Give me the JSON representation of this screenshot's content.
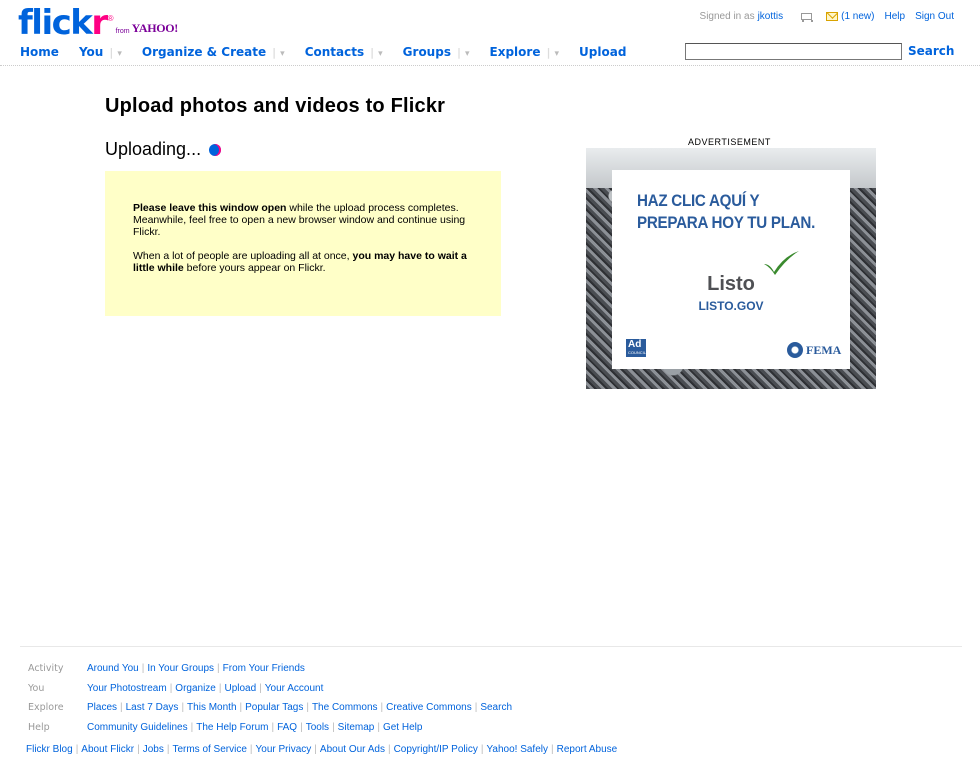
{
  "brand": {
    "flick": "flick",
    "r": "r",
    "reg": "®",
    "from": "from",
    "yahoo": "YAHOO!"
  },
  "account": {
    "signed_in_as": "Signed in as",
    "username": "jkottis",
    "new_mail": "(1 new)",
    "help": "Help",
    "sign_out": "Sign Out"
  },
  "nav": {
    "home": "Home",
    "you": "You",
    "organize": "Organize & Create",
    "contacts": "Contacts",
    "groups": "Groups",
    "explore": "Explore",
    "upload": "Upload",
    "dropdown_glyph": "▾"
  },
  "search": {
    "value": "",
    "button": "Search"
  },
  "main": {
    "title": "Upload photos and videos to Flickr",
    "status": "Uploading...",
    "notice_p1_bold": "Please leave this window open",
    "notice_p1_rest": " while the upload process completes. Meanwhile, feel free to open a new browser window and continue using Flickr.",
    "notice_p2_start": "When a lot of people are uploading all at once, ",
    "notice_p2_bold": "you may have to wait a little while",
    "notice_p2_end": " before yours appear on Flickr."
  },
  "ad": {
    "label": "ADVERTISEMENT",
    "headline_line1": "HAZ CLIC AQUÍ Y",
    "headline_line2": "PREPARA HOY TU PLAN.",
    "brand": "Listo",
    "url": "LISTO.GOV",
    "adcouncil": "Ad",
    "adcouncil_small": "COUNCIL",
    "fema": "FEMA"
  },
  "footer": {
    "rows": [
      {
        "label": "Activity",
        "links": [
          "Around You",
          "In Your Groups",
          "From Your Friends"
        ]
      },
      {
        "label": "You",
        "links": [
          "Your Photostream",
          "Organize",
          "Upload",
          "Your Account"
        ]
      },
      {
        "label": "Explore",
        "links": [
          "Places",
          "Last 7 Days",
          "This Month",
          "Popular Tags",
          "The Commons",
          "Creative Commons",
          "Search"
        ]
      },
      {
        "label": "Help",
        "links": [
          "Community Guidelines",
          "The Help Forum",
          "FAQ",
          "Tools",
          "Sitemap",
          "Get Help"
        ]
      }
    ],
    "bottom_links": [
      "Flickr Blog",
      "About Flickr",
      "Jobs",
      "Terms of Service",
      "Your Privacy",
      "About Our Ads",
      "Copyright/IP Policy",
      "Yahoo! Safely",
      "Report Abuse"
    ],
    "separator": "|"
  },
  "colors": {
    "flickr_blue": "#0063dc",
    "flickr_pink": "#ff0084",
    "notice_bg": "#ffffc8",
    "ad_blue": "#2a5b9c"
  },
  "icons": [
    "cart-icon",
    "mail-icon",
    "upload-progress-dot-icon",
    "checkmark-icon",
    "fema-seal-icon"
  ]
}
